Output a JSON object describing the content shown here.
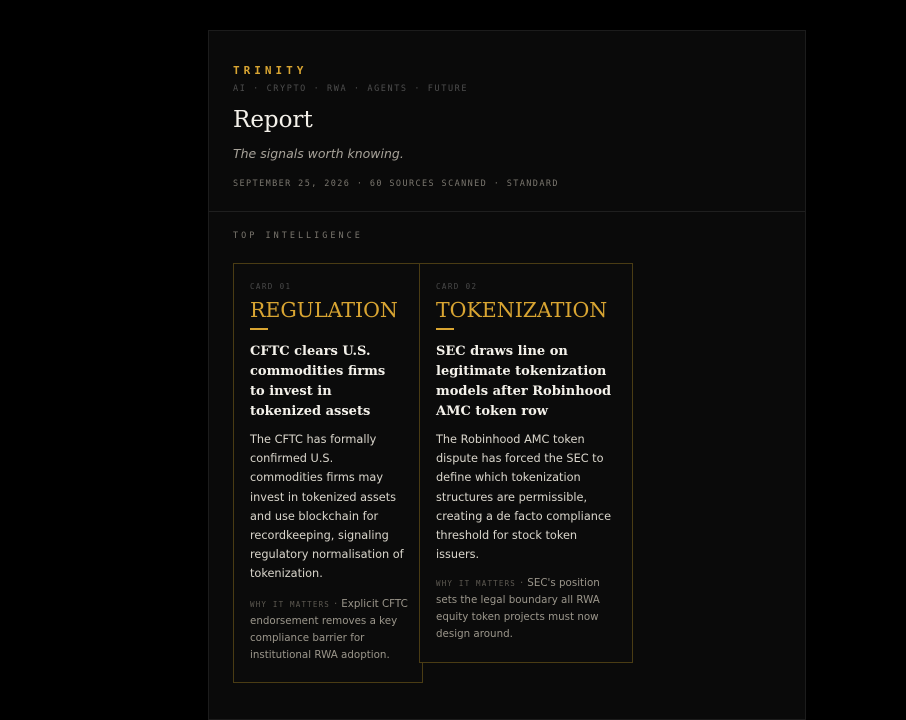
{
  "header": {
    "brand": "TRINITY",
    "tags": "AI · CRYPTO · RWA · AGENTS · FUTURE",
    "title": "Report",
    "tagline": "The signals worth knowing.",
    "meta": "SEPTEMBER 25, 2026 · 60 SOURCES SCANNED · STANDARD"
  },
  "section": {
    "label": "TOP INTELLIGENCE"
  },
  "colors": {
    "accent": "#d9a532",
    "background": "#000000",
    "panel": "#0a0a0a",
    "card_border": "#4a3c14"
  },
  "cards": [
    {
      "number": "CARD 01",
      "category": "REGULATION",
      "headline": "CFTC clears U.S. commodities firms to invest in tokenized assets",
      "body": "The CFTC has formally confirmed U.S. commodities firms may invest in tokenized assets and use blockchain for recordkeeping, signaling regulatory normalisation of tokenization.",
      "why_label": "WHY IT MATTERS",
      "why_text": "Explicit CFTC endorsement removes a key compliance barrier for institutional RWA adoption."
    },
    {
      "number": "CARD 02",
      "category": "TOKENIZATION",
      "headline": "SEC draws line on legitimate tokenization models after Robinhood AMC token row",
      "body": "The Robinhood AMC token dispute has forced the SEC to define which tokenization structures are permissible, creating a de facto compliance threshold for stock token issuers.",
      "why_label": "WHY IT MATTERS",
      "why_text": "SEC's position sets the legal boundary all RWA equity token projects must now design around."
    }
  ]
}
